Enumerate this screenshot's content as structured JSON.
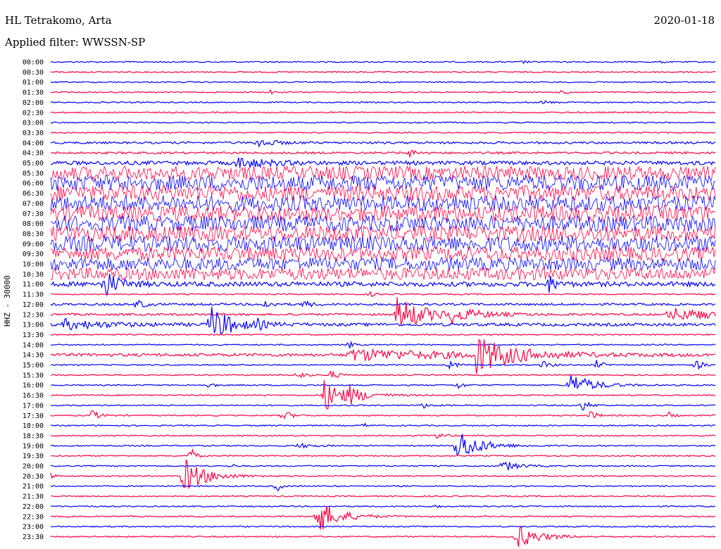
{
  "header": {
    "station": "HL Tetrakomo, Arta",
    "date": "2020-01-18",
    "filter": "Applied filter: WWSSN-SP"
  },
  "axis": {
    "ylabel": "HHZ - 30000"
  },
  "colors": {
    "blue": "#0000ff",
    "red": "#ff0040"
  },
  "chart_data": {
    "type": "line",
    "title": "HL Tetrakomo, Arta",
    "subtitle": "Applied filter: WWSSN-SP",
    "ylabel": "HHZ - 30000",
    "traces": [
      {
        "label": "00:00",
        "color": "blue",
        "noise": 1,
        "events": [
          [
            0.17,
            2,
            0.003
          ],
          [
            0.71,
            3,
            0.003
          ],
          [
            0.92,
            2,
            0.003
          ]
        ]
      },
      {
        "label": "00:30",
        "color": "red",
        "noise": 1,
        "events": []
      },
      {
        "label": "01:00",
        "color": "blue",
        "noise": 1,
        "events": []
      },
      {
        "label": "01:30",
        "color": "red",
        "noise": 1,
        "events": [
          [
            0.33,
            3,
            0.005
          ],
          [
            0.77,
            4,
            0.008
          ]
        ]
      },
      {
        "label": "02:00",
        "color": "blue",
        "noise": 1,
        "events": [
          [
            0.74,
            3,
            0.01
          ]
        ]
      },
      {
        "label": "02:30",
        "color": "red",
        "noise": 1,
        "events": []
      },
      {
        "label": "03:00",
        "color": "blue",
        "noise": 1,
        "events": []
      },
      {
        "label": "03:30",
        "color": "red",
        "noise": 1,
        "events": []
      },
      {
        "label": "04:00",
        "color": "blue",
        "noise": 2,
        "events": [
          [
            0.31,
            8,
            0.02
          ]
        ]
      },
      {
        "label": "04:30",
        "color": "red",
        "noise": 2,
        "events": [
          [
            0.54,
            5,
            0.01
          ]
        ]
      },
      {
        "label": "05:00",
        "color": "blue",
        "noise": 4,
        "events": [
          [
            0.28,
            8,
            0.04
          ]
        ]
      },
      {
        "label": "05:30",
        "color": "red",
        "noise": 16,
        "events": []
      },
      {
        "label": "06:00",
        "color": "blue",
        "noise": 18,
        "events": []
      },
      {
        "label": "06:30",
        "color": "red",
        "noise": 18,
        "events": []
      },
      {
        "label": "07:00",
        "color": "blue",
        "noise": 18,
        "events": []
      },
      {
        "label": "07:30",
        "color": "red",
        "noise": 18,
        "events": []
      },
      {
        "label": "08:00",
        "color": "blue",
        "noise": 18,
        "events": []
      },
      {
        "label": "08:30",
        "color": "red",
        "noise": 18,
        "events": []
      },
      {
        "label": "09:00",
        "color": "blue",
        "noise": 18,
        "events": []
      },
      {
        "label": "09:30",
        "color": "red",
        "noise": 16,
        "events": []
      },
      {
        "label": "10:00",
        "color": "blue",
        "noise": 15,
        "events": []
      },
      {
        "label": "10:30",
        "color": "red",
        "noise": 14,
        "events": []
      },
      {
        "label": "11:00",
        "color": "blue",
        "noise": 5,
        "events": [
          [
            0.08,
            20,
            0.02
          ],
          [
            0.75,
            12,
            0.01
          ]
        ]
      },
      {
        "label": "11:30",
        "color": "red",
        "noise": 1,
        "events": [
          [
            0.48,
            3,
            0.01
          ]
        ]
      },
      {
        "label": "12:00",
        "color": "blue",
        "noise": 2,
        "events": [
          [
            0.13,
            8,
            0.01
          ],
          [
            0.32,
            7,
            0.01
          ],
          [
            0.38,
            6,
            0.01
          ]
        ]
      },
      {
        "label": "12:30",
        "color": "red",
        "noise": 2,
        "events": [
          [
            0.52,
            26,
            0.04
          ],
          [
            0.6,
            9,
            0.04
          ],
          [
            0.93,
            9,
            0.08
          ]
        ]
      },
      {
        "label": "13:00",
        "color": "blue",
        "noise": 3,
        "events": [
          [
            0.02,
            7,
            0.06
          ],
          [
            0.24,
            26,
            0.03
          ],
          [
            0.31,
            6,
            0.01
          ]
        ]
      },
      {
        "label": "13:30",
        "color": "red",
        "noise": 1,
        "events": []
      },
      {
        "label": "14:00",
        "color": "blue",
        "noise": 1,
        "events": [
          [
            0.45,
            5,
            0.005
          ]
        ]
      },
      {
        "label": "14:30",
        "color": "red",
        "noise": 3,
        "events": [
          [
            0.45,
            8,
            0.15
          ],
          [
            0.64,
            26,
            0.05
          ]
        ]
      },
      {
        "label": "15:00",
        "color": "blue",
        "noise": 1,
        "events": [
          [
            0.6,
            6,
            0.01
          ],
          [
            0.74,
            6,
            0.01
          ],
          [
            0.82,
            7,
            0.01
          ],
          [
            0.97,
            8,
            0.01
          ]
        ]
      },
      {
        "label": "15:30",
        "color": "red",
        "noise": 1,
        "events": [
          [
            0.37,
            6,
            0.01
          ],
          [
            0.42,
            7,
            0.01
          ]
        ]
      },
      {
        "label": "16:00",
        "color": "blue",
        "noise": 1,
        "events": [
          [
            0.24,
            6,
            0.005
          ],
          [
            0.61,
            6,
            0.01
          ],
          [
            0.78,
            18,
            0.03
          ]
        ]
      },
      {
        "label": "16:30",
        "color": "red",
        "noise": 1,
        "events": [
          [
            0.41,
            24,
            0.03
          ],
          [
            0.45,
            8,
            0.02
          ]
        ]
      },
      {
        "label": "17:00",
        "color": "blue",
        "noise": 1,
        "events": [
          [
            0.56,
            4,
            0.01
          ],
          [
            0.8,
            8,
            0.01
          ]
        ]
      },
      {
        "label": "17:30",
        "color": "red",
        "noise": 1,
        "events": [
          [
            0.06,
            9,
            0.01
          ],
          [
            0.35,
            8,
            0.01
          ],
          [
            0.81,
            7,
            0.01
          ],
          [
            0.93,
            7,
            0.005
          ]
        ]
      },
      {
        "label": "18:00",
        "color": "blue",
        "noise": 1,
        "events": [
          [
            0.47,
            4,
            0.005
          ]
        ]
      },
      {
        "label": "18:30",
        "color": "red",
        "noise": 1,
        "events": [
          [
            0.58,
            5,
            0.01
          ]
        ]
      },
      {
        "label": "19:00",
        "color": "blue",
        "noise": 1,
        "events": [
          [
            0.37,
            4,
            0.02
          ],
          [
            0.61,
            26,
            0.03
          ]
        ]
      },
      {
        "label": "19:30",
        "color": "red",
        "noise": 1,
        "events": [
          [
            0.21,
            22,
            0.005
          ]
        ]
      },
      {
        "label": "20:00",
        "color": "blue",
        "noise": 1,
        "events": [
          [
            0.27,
            4,
            0.005
          ],
          [
            0.68,
            8,
            0.02
          ]
        ]
      },
      {
        "label": "20:30",
        "color": "red",
        "noise": 1,
        "events": [
          [
            0.0,
            6,
            0.005
          ],
          [
            0.2,
            26,
            0.03
          ]
        ]
      },
      {
        "label": "21:00",
        "color": "blue",
        "noise": 1,
        "events": [
          [
            0.34,
            9,
            0.005
          ]
        ]
      },
      {
        "label": "21:30",
        "color": "red",
        "noise": 1,
        "events": []
      },
      {
        "label": "22:00",
        "color": "blue",
        "noise": 1,
        "events": [
          [
            0.58,
            3,
            0.005
          ]
        ]
      },
      {
        "label": "22:30",
        "color": "red",
        "noise": 1,
        "events": [
          [
            0.4,
            26,
            0.03
          ]
        ]
      },
      {
        "label": "23:00",
        "color": "blue",
        "noise": 1,
        "events": []
      },
      {
        "label": "23:30",
        "color": "red",
        "noise": 1,
        "events": [
          [
            0.7,
            18,
            0.03
          ]
        ]
      }
    ]
  }
}
